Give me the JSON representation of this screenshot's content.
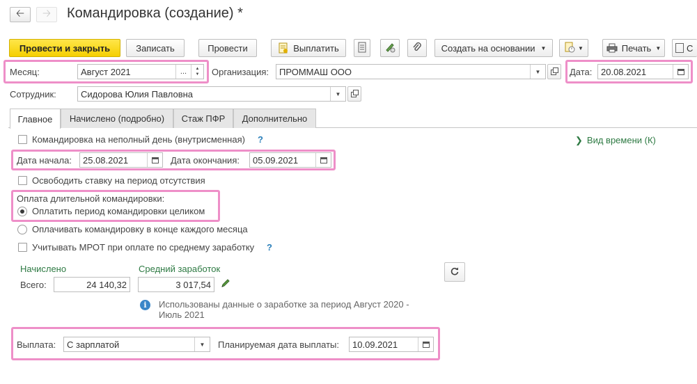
{
  "window": {
    "title": "Командировка (создание) *"
  },
  "toolbar": {
    "post_and_close": "Провести и закрыть",
    "save": "Записать",
    "post": "Провести",
    "pay": "Выплатить",
    "create_based_on": "Создать на основании",
    "print": "Печать",
    "overflow_text": "С"
  },
  "header": {
    "month_label": "Месяц:",
    "month_value": "Август 2021",
    "month_choice": "...",
    "org_label": "Организация:",
    "org_value": "ПРОММАШ ООО",
    "date_label": "Дата:",
    "date_value": "20.08.2021",
    "employee_label": "Сотрудник:",
    "employee_value": "Сидорова Юлия Павловна"
  },
  "tabs": [
    {
      "label": "Главное",
      "active": true
    },
    {
      "label": "Начислено (подробно)",
      "active": false
    },
    {
      "label": "Стаж ПФР",
      "active": false
    },
    {
      "label": "Дополнительно",
      "active": false
    }
  ],
  "main": {
    "partial_day_label": "Командировка на неполный день (внутрисменная)",
    "partial_day_checked": false,
    "help_mark": "?",
    "time_kind_link": "Вид времени (К)",
    "start_label": "Дата начала:",
    "start_value": "25.08.2021",
    "end_label": "Дата окончания:",
    "end_value": "05.09.2021",
    "free_rate_label": "Освободить ставку на период отсутствия",
    "free_rate_checked": false,
    "long_trip_title": "Оплата длительной командировки:",
    "pay_whole_label": "Оплатить период командировки целиком",
    "pay_monthly_label": "Оплачивать командировку в конце каждого месяца",
    "selected_option": "pay_whole",
    "mrot_label": "Учитывать МРОТ при оплате по среднему заработку",
    "mrot_checked": false,
    "accrued_title": "Начислено",
    "total_label": "Всего:",
    "total_value": "24 140,32",
    "avg_title": "Средний заработок",
    "avg_value": "3 017,54",
    "info_text_1": "Использованы данные о заработке за период Август 2020 -",
    "info_text_2": "Июль 2021",
    "payout_label": "Выплата:",
    "payout_value": "С зарплатой",
    "planned_date_label": "Планируемая дата выплаты:",
    "planned_date_value": "10.09.2021"
  },
  "colors": {
    "primary_button": "#f5cf00",
    "highlight_frame": "#ee8fc8",
    "link_green": "#2e7a43",
    "help_blue": "#2a7fba"
  },
  "icons": [
    "back-arrow-icon",
    "forward-arrow-icon",
    "payment-doc-icon",
    "list-icon",
    "edit-icon",
    "paperclip-icon",
    "report-icon",
    "printer-icon",
    "calendar-icon",
    "open-icon",
    "refresh-icon",
    "pencil-icon",
    "info-icon",
    "chevron-right-icon"
  ]
}
